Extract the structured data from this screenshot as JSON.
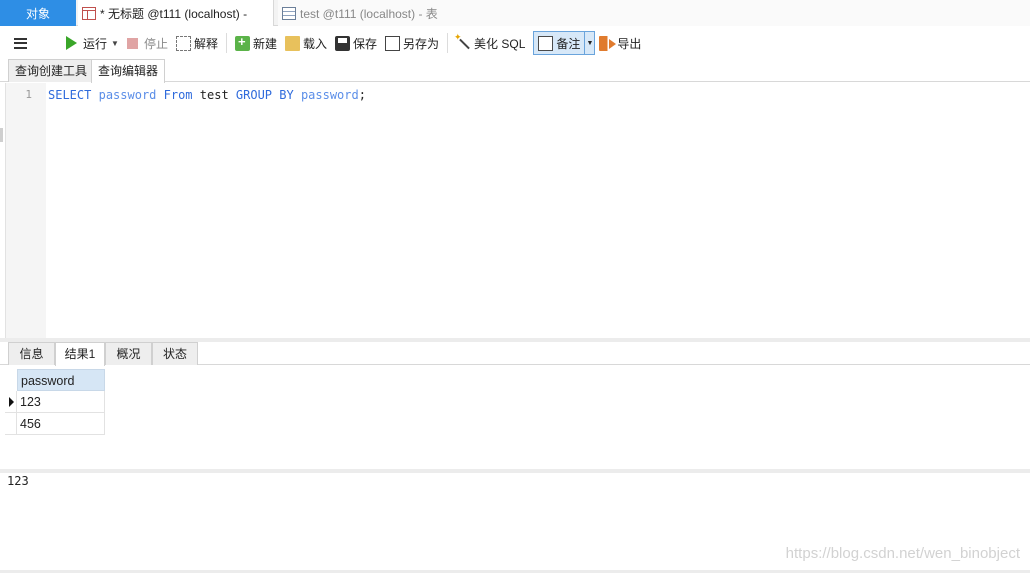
{
  "document_tabs": {
    "object": "对象",
    "untitled_query": "* 无标题 @t111 (localhost) -",
    "table": "test @t111 (localhost) - 表"
  },
  "toolbar": {
    "run": "运行",
    "stop": "停止",
    "explain": "解释",
    "new": "新建",
    "load": "载入",
    "save": "保存",
    "save_as": "另存为",
    "beautify": "美化 SQL",
    "notes": "备注",
    "export": "导出"
  },
  "sub_tabs": {
    "query_builder": "查询创建工具",
    "query_editor": "查询编辑器"
  },
  "editor": {
    "line_number": "1",
    "tokens": {
      "select": "SELECT",
      "column1": "password",
      "from": "From",
      "table": "test",
      "group_by": "GROUP BY",
      "column2": "password",
      "end": ";"
    }
  },
  "result_tabs": {
    "info": "信息",
    "result1": "结果1",
    "overview": "概况",
    "status": "状态"
  },
  "grid": {
    "header": "password",
    "rows": [
      "123",
      "456"
    ]
  },
  "bottom_panel": {
    "value": "123",
    "watermark": "https://blog.csdn.net/wen_binobject"
  }
}
